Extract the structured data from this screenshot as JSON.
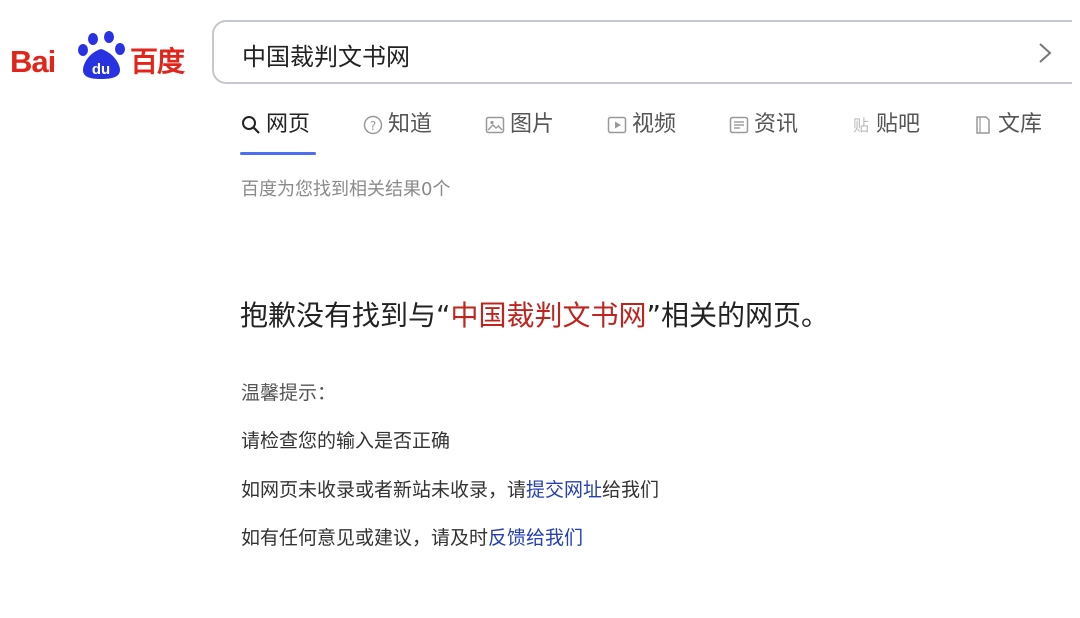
{
  "logo": {
    "latin": "Bai",
    "paw_text": "du",
    "chinese": "百度",
    "brand_red": "#e1251b",
    "paw_blue": "#2932e1"
  },
  "search": {
    "value": "中国裁判文书网",
    "clear_icon": "close-icon"
  },
  "tabs": [
    {
      "label": "网页",
      "icon": "search-icon",
      "active": true
    },
    {
      "label": "知道",
      "icon": "question-circle-icon",
      "active": false
    },
    {
      "label": "图片",
      "icon": "image-icon",
      "active": false
    },
    {
      "label": "视频",
      "icon": "video-icon",
      "active": false
    },
    {
      "label": "资讯",
      "icon": "news-icon",
      "active": false
    },
    {
      "label": "贴吧",
      "icon": "tieba-icon",
      "active": false
    },
    {
      "label": "文库",
      "icon": "document-icon",
      "active": false
    }
  ],
  "accent_color": "#4e6ef2",
  "result_count": "百度为您找到相关结果0个",
  "no_result": {
    "prefix": "抱歉没有找到与“",
    "keyword": "中国裁判文书网",
    "suffix": "”相关的网页。",
    "keyword_color": "#c0241f"
  },
  "tips": {
    "title": "温馨提示：",
    "line1": "请检查您的输入是否正确",
    "line2_prefix": "如网页未收录或者新站未收录，请",
    "line2_link": "提交网址",
    "line2_suffix": "给我们",
    "line3_prefix": "如有任何意见或建议，请及时",
    "line3_link": "反馈给我们",
    "link_color": "#2440b3"
  }
}
